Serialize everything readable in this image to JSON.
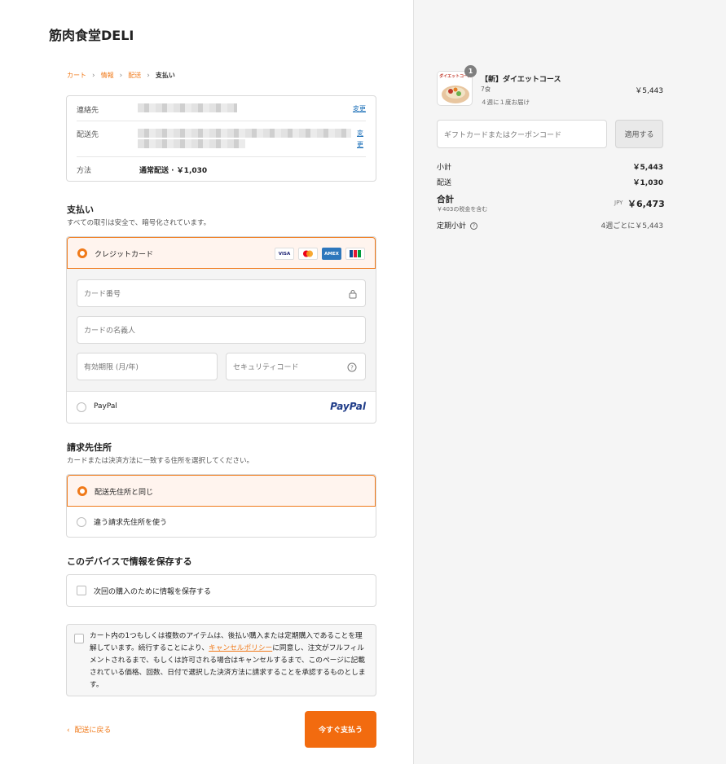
{
  "store": {
    "name": "筋肉食堂DELI"
  },
  "breadcrumb": {
    "cart": "カート",
    "info": "情報",
    "shipping": "配送",
    "payment": "支払い"
  },
  "summary": {
    "contact_label": "連絡先",
    "shipto_label": "配送先",
    "method_label": "方法",
    "method_value": "通常配送 · ￥1,030",
    "change": "変更",
    "change_a": "変",
    "change_b": "更"
  },
  "payment": {
    "title": "支払い",
    "subtitle": "すべての取引は安全で、暗号化されています。",
    "credit_label": "クレジットカード",
    "card_logos": [
      "VISA",
      "MC",
      "AMEX",
      "JCB"
    ],
    "card_number_placeholder": "カード番号",
    "card_name_placeholder": "カードの名義人",
    "expiry_placeholder": "有効期限 (月/年)",
    "cvc_placeholder": "セキュリティコード",
    "paypal_label": "PayPal",
    "paypal_logo": "PayPal"
  },
  "billing": {
    "title": "請求先住所",
    "subtitle": "カードまたは決済方法に一致する住所を選択してください。",
    "same_label": "配送先住所と同じ",
    "different_label": "違う請求先住所を使う"
  },
  "save": {
    "title": "このデバイスで情報を保存する",
    "checkbox_label": "次回の購入のために情報を保存する"
  },
  "terms": {
    "before": "カート内の1つもしくは複数のアイテムは、後払い購入または定期購入であることを理解しています。続行することにより、",
    "link": "キャンセルポリシー",
    "after": "に同意し、注文がフルフィルメントされるまで、もしくは許可される場合はキャンセルするまで、このページに記載されている価格、回数、日付で選択した決済方法に請求することを承認するものとします。"
  },
  "actions": {
    "back": "配送に戻る",
    "pay": "今すぐ支払う"
  },
  "order": {
    "quantity": "1",
    "item_name": "【新】ダイエットコース",
    "item_variant": "7食",
    "item_schedule": "４週に１度お届け",
    "item_price": "￥5,443",
    "thumb_label": "ダイエットコース",
    "coupon_placeholder": "ギフトカードまたはクーポンコード",
    "apply": "適用する",
    "subtotal_label": "小計",
    "subtotal": "￥5,443",
    "shipping_label": "配送",
    "shipping": "￥1,030",
    "total_label": "合計",
    "tax_note": "￥403の税金を含む",
    "currency": "JPY",
    "total": "￥6,473",
    "recurring_label": "定期小計",
    "recurring_value": "4週ごとに￥5,443"
  },
  "colors": {
    "accent": "#f26b0f",
    "link": "#1b6fb8"
  }
}
